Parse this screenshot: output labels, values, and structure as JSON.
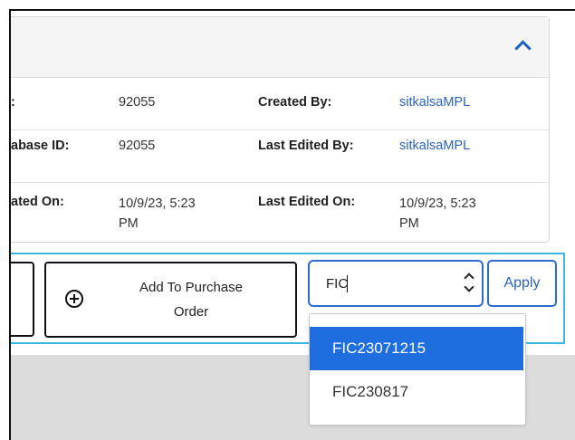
{
  "details": {
    "col1": {
      "row1_label": ":",
      "row2_label": "abase ID:",
      "row3_label": "ated On:"
    },
    "col2": {
      "row1_value": "92055",
      "row2_value": "92055",
      "row3_value_line1": "10/9/23, 5:23",
      "row3_value_line2": "PM"
    },
    "col3": {
      "row1_label": "Created By:",
      "row2_label": "Last Edited By:",
      "row3_label": "Last Edited On:"
    },
    "col4": {
      "row1_value": "sitkalsaMPL",
      "row2_value": "sitkalsaMPL",
      "row3_value_line1": "10/9/23, 5:23",
      "row3_value_line2": "PM"
    }
  },
  "toolbar": {
    "add_to_po_line1": "Add To Purchase",
    "add_to_po_line2": "Order",
    "lot_input_value": "FIC",
    "apply_label": "Apply"
  },
  "dropdown": {
    "options": [
      "FIC23071215",
      "FIC230817"
    ],
    "selected_index": 0
  },
  "icons": {
    "collapse": "chevron-up-icon",
    "add": "plus-circle-icon",
    "spinner": "spinner-arrows-icon"
  },
  "colors": {
    "accent": "#2e6bd1",
    "link": "#2b63b8",
    "selected_bg": "#1e6ee0",
    "toolbar_border": "#3bb7e3"
  }
}
